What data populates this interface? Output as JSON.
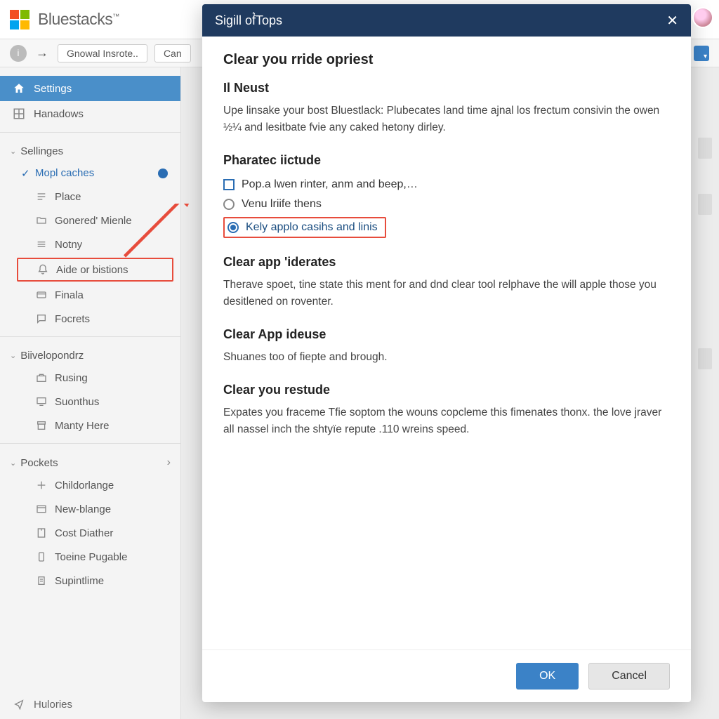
{
  "brand": "Bluestacks",
  "toolbar": {
    "btn1": "Gnowal Insrote..",
    "btn2": "Can"
  },
  "sidebar": {
    "settings_label": "Settings",
    "hanadows_label": "Hanadows",
    "group_sellinges": "Sellinges",
    "mopl_caches": "Mopl caches",
    "place": "Place",
    "gonered": "Gonered' Mienle",
    "notny": "Notny",
    "aide": "Aide or bistions",
    "finala": "Finala",
    "focrets": "Focrets",
    "group_dev": "Biivelopondrz",
    "rusing": "Rusing",
    "suonthus": "Suonthus",
    "manty": "Manty Here",
    "group_pockets": "Pockets",
    "childorlange": "Childorlange",
    "newblange": "New-blange",
    "costdiather": "Cost Diather",
    "toeine": "Toeine Pugable",
    "supintime": "Supintlime",
    "hulories": "Hulories"
  },
  "modal": {
    "title": "Sigill of͛Tops",
    "heading": "Clear you rride opriest",
    "sec1_title": "Il Neust",
    "sec1_body": "Upe linsake your bost Bluestlack: Plubecates land time ajnal los frectum consivin the owen ½¼ and lesitbate fvie any caked hetony dirley.",
    "sec2_title": "Pharatec iictude",
    "opt1": "Pop.a lwen rinter, anm and beep,…",
    "opt2": "Venu lriife thens",
    "opt3": "Kely applo casihs and linis",
    "sec3_title": "Clear app 'iderates",
    "sec3_body": "Therave spoet, tine state this ment for and dnd clear tool relphave the will apple those you desitlened on roventer.",
    "sec4_title": "Clear App ideuse",
    "sec4_body": "Shuanes too of fiepte and brough.",
    "sec5_title": "Clear you restude",
    "sec5_body": "Expates you fraceme Tfie soptom the wouns copcleme this fimenates thonx. the love jraver all nassel inch the shtyïe repute .110 wreins speed.",
    "ok": "OK",
    "cancel": "Cancel"
  }
}
